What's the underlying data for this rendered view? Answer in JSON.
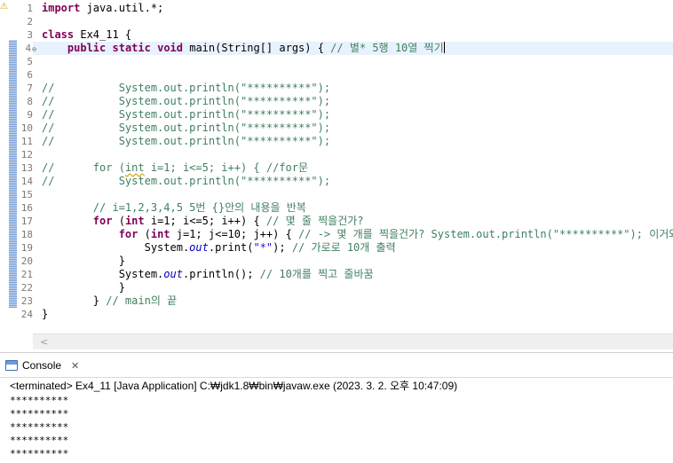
{
  "editor": {
    "line_numbers": [
      "1",
      "2",
      "3",
      "4",
      "5",
      "6",
      "7",
      "8",
      "9",
      "10",
      "11",
      "12",
      "13",
      "14",
      "15",
      "16",
      "17",
      "18",
      "19",
      "20",
      "21",
      "22",
      "23",
      "24"
    ],
    "lines": [
      [
        {
          "t": "import",
          "c": "kw"
        },
        {
          "t": " java.util.*;"
        }
      ],
      [],
      [
        {
          "t": "class",
          "c": "kw"
        },
        {
          "t": " Ex4_11 {"
        }
      ],
      [
        {
          "t": "    "
        },
        {
          "t": "public",
          "c": "kw"
        },
        {
          "t": " "
        },
        {
          "t": "static",
          "c": "kw"
        },
        {
          "t": " "
        },
        {
          "t": "void",
          "c": "kw"
        },
        {
          "t": " main(String[] args) { "
        },
        {
          "t": "// 별* 5행 10열 찍기",
          "c": "cm"
        },
        {
          "t": "",
          "c": "caret"
        }
      ],
      [],
      [],
      [
        {
          "t": "//          System.out.println(\"**********\");",
          "c": "cm"
        }
      ],
      [
        {
          "t": "//          System.out.println(\"**********\");",
          "c": "cm"
        }
      ],
      [
        {
          "t": "//          System.out.println(\"**********\");",
          "c": "cm"
        }
      ],
      [
        {
          "t": "//          System.out.println(\"**********\");",
          "c": "cm"
        }
      ],
      [
        {
          "t": "//          System.out.println(\"**********\");",
          "c": "cm"
        }
      ],
      [],
      [
        {
          "t": "//      for (",
          "c": "cm"
        },
        {
          "t": "int",
          "c": "cm sq"
        },
        {
          "t": " i=1; i<=5; i++) { //for문",
          "c": "cm"
        }
      ],
      [
        {
          "t": "//          System.out.println(\"**********\");",
          "c": "cm"
        }
      ],
      [],
      [
        {
          "t": "        "
        },
        {
          "t": "// i=1,2,3,4,5 5번 {}안의 내용을 반복",
          "c": "cm"
        }
      ],
      [
        {
          "t": "        "
        },
        {
          "t": "for",
          "c": "kw"
        },
        {
          "t": " ("
        },
        {
          "t": "int",
          "c": "kw"
        },
        {
          "t": " i=1; i<=5; i++) { "
        },
        {
          "t": "// 몇 줄 찍을건가?",
          "c": "cm"
        }
      ],
      [
        {
          "t": "            "
        },
        {
          "t": "for",
          "c": "kw"
        },
        {
          "t": " ("
        },
        {
          "t": "int",
          "c": "kw"
        },
        {
          "t": " j=1; j<=10; j++) { "
        },
        {
          "t": "// -> 몇 개를 찍을건가? System.out.println(\"**********\"); 이거와 같음",
          "c": "cm"
        }
      ],
      [
        {
          "t": "                System."
        },
        {
          "t": "out",
          "c": "fld"
        },
        {
          "t": ".print("
        },
        {
          "t": "\"*\"",
          "c": "str"
        },
        {
          "t": "); "
        },
        {
          "t": "// 가로로 10개 출력",
          "c": "cm"
        }
      ],
      [
        {
          "t": "            }"
        }
      ],
      [
        {
          "t": "            System."
        },
        {
          "t": "out",
          "c": "fld"
        },
        {
          "t": ".println(); "
        },
        {
          "t": "// 10개를 찍고 줄바꿈",
          "c": "cm"
        }
      ],
      [
        {
          "t": "            }"
        }
      ],
      [
        {
          "t": "        } "
        },
        {
          "t": "// main의 끝",
          "c": "cm"
        }
      ],
      [
        {
          "t": "}"
        }
      ]
    ],
    "scroll_left_glyph": "<"
  },
  "console": {
    "tab_label": "Console",
    "close_glyph": "✕",
    "status": "<terminated> Ex4_11 [Java Application] C:₩jdk1.8₩bin₩javaw.exe (2023. 3. 2. 오후 10:47:09)",
    "output": [
      "**********",
      "**********",
      "**********",
      "**********",
      "**********"
    ]
  }
}
